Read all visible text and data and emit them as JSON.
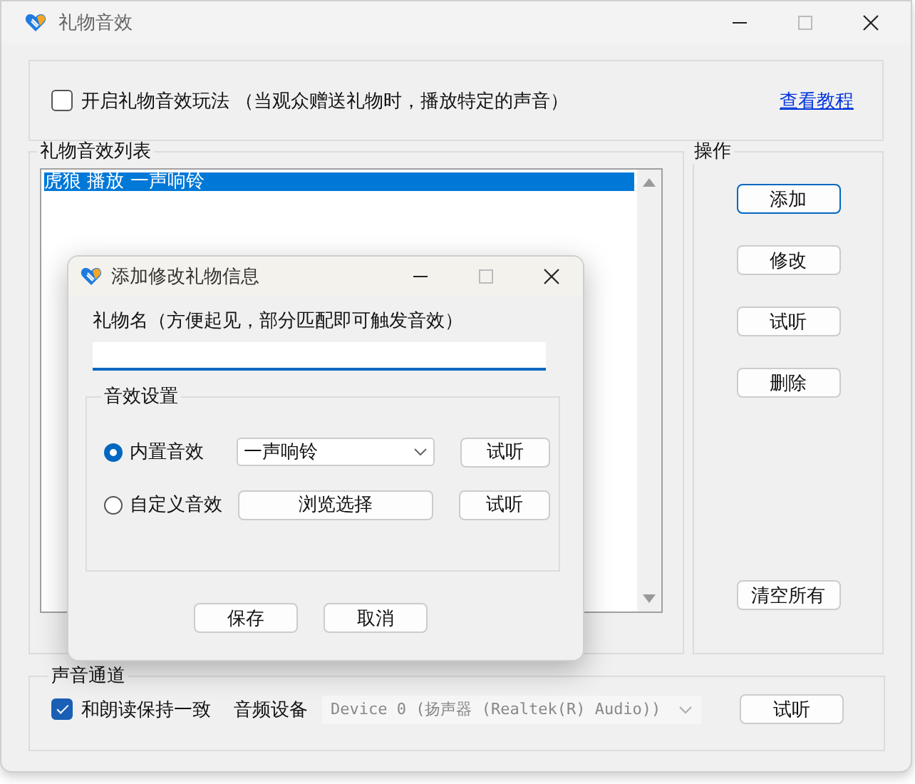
{
  "window": {
    "title": "礼物音效"
  },
  "enable_option": {
    "label": "开启礼物音效玩法 （当观众赠送礼物时，播放特定的声音）",
    "checked": false
  },
  "tutorial_link": "查看教程",
  "gift_list": {
    "title": "礼物音效列表",
    "items": [
      {
        "text": "虎狼 播放 一声响铃",
        "selected": true
      }
    ]
  },
  "operations": {
    "title": "操作",
    "buttons": [
      {
        "label": "添加",
        "focused": true
      },
      {
        "label": "修改",
        "focused": false
      },
      {
        "label": "试听",
        "focused": false
      },
      {
        "label": "删除",
        "focused": false
      },
      {
        "label": "清空所有",
        "focused": false
      }
    ]
  },
  "sound_channel": {
    "title": "声音通道",
    "sync_checkbox": {
      "label": "和朗读保持一致",
      "checked": true
    },
    "device_label": "音频设备",
    "device": {
      "value": "Device 0 (扬声器 (Realtek(R) Audio))",
      "disabled": true
    },
    "button": "试听"
  },
  "dialog": {
    "title": "添加修改礼物信息",
    "name_label": "礼物名（方便起见，部分匹配即可触发音效）",
    "sound_settings": {
      "title": "音效设置",
      "options": [
        {
          "kind": "builtin",
          "label": "内置音效",
          "selected": true,
          "value": "一声响铃",
          "button": "试听"
        },
        {
          "kind": "custom",
          "label": "自定义音效",
          "selected": false,
          "browse": "浏览选择",
          "button": "试听"
        }
      ]
    },
    "buttons": [
      "保存",
      "取消"
    ]
  }
}
